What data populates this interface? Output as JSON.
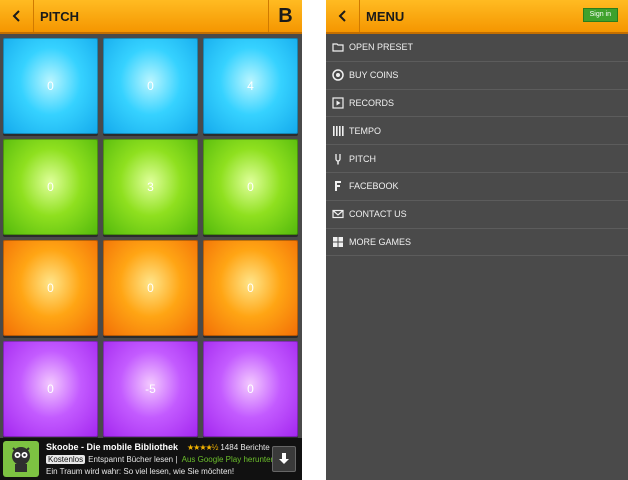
{
  "left_screen": {
    "title": "PITCH",
    "badge_letter": "B",
    "pads": [
      {
        "value": "0",
        "color": "cyan"
      },
      {
        "value": "0",
        "color": "cyan"
      },
      {
        "value": "4",
        "color": "cyan"
      },
      {
        "value": "0",
        "color": "green"
      },
      {
        "value": "3",
        "color": "green"
      },
      {
        "value": "0",
        "color": "green"
      },
      {
        "value": "0",
        "color": "orange"
      },
      {
        "value": "0",
        "color": "orange"
      },
      {
        "value": "0",
        "color": "orange"
      },
      {
        "value": "0",
        "color": "purple"
      },
      {
        "value": "-5",
        "color": "purple"
      },
      {
        "value": "0",
        "color": "purple"
      }
    ],
    "ad": {
      "title": "Skoobe - Die mobile Bibliothek",
      "stars": "★★★★½",
      "reviews": "1484 Berichte",
      "tag": "Kostenlos",
      "tagline": "Entspannt Bücher lesen",
      "store": "Aus Google Play herunterladen",
      "slogan": "Ein Traum wird wahr: So viel lesen, wie Sie möchten!",
      "icon": "download-icon"
    }
  },
  "right_screen": {
    "title": "MENU",
    "signin_label": "Sign in",
    "menu": [
      {
        "label": "OPEN PRESET",
        "icon": "folder-icon"
      },
      {
        "label": "BUY COINS",
        "icon": "coin-icon"
      },
      {
        "label": "RECORDS",
        "icon": "play-icon"
      },
      {
        "label": "TEMPO",
        "icon": "tempo-bars-icon"
      },
      {
        "label": "PITCH",
        "icon": "tuning-fork-icon"
      },
      {
        "label": "FACEBOOK",
        "icon": "facebook-icon"
      },
      {
        "label": "CONTACT US",
        "icon": "envelope-icon"
      },
      {
        "label": "MORE GAMES",
        "icon": "grid-icon"
      }
    ]
  },
  "colors": {
    "topbar": "#f7a10a",
    "background": "#4a4a4a",
    "pad_cyan": "#14a9ec",
    "pad_green": "#52b80c",
    "pad_orange": "#f26e06",
    "pad_purple": "#a326ef",
    "signin": "#3fa12c"
  }
}
